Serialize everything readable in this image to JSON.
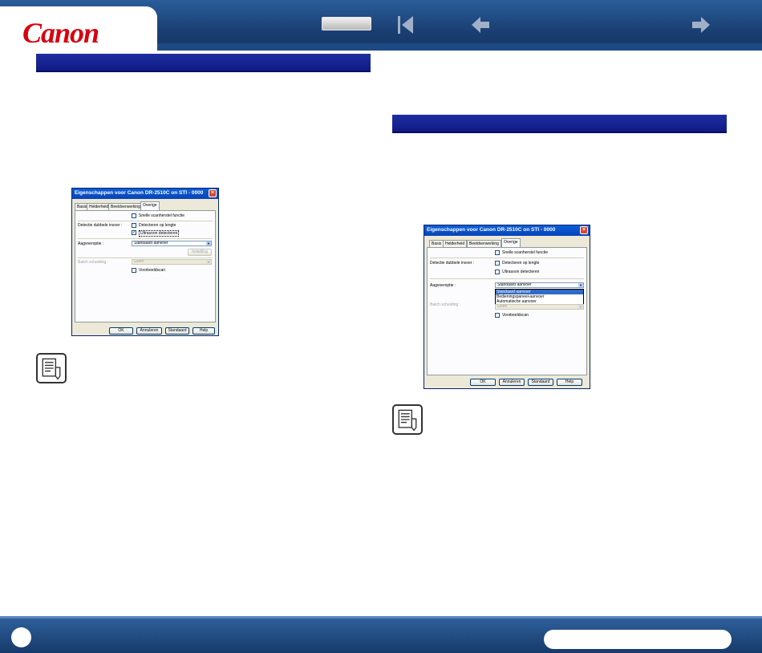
{
  "header": {
    "logo_text": "Canon",
    "nav_icons": [
      "first-page-icon",
      "back-arrow-icon",
      "forward-arrow-icon"
    ]
  },
  "dialog1": {
    "title": "Eigenschappen voor Canon DR-2510C on STI - 0000",
    "tabs": [
      "Basis",
      "Helderheid",
      "Beeldverwerking",
      "Overige"
    ],
    "active_tab": "Overige",
    "snelle_label": "Snelle scanherstel functie",
    "dubbele_label": "Detectie dubbele invoer :",
    "detecteren_lengte": "Detecteren op lengte",
    "ultrasoon": "Ultrasoon detecteren",
    "aanvoer_label": "Aagvoeroptie :",
    "aanvoer_value": "Standaard aanvoer",
    "instelling_btn": "Instelling",
    "batch_label": "Batch scheiding :",
    "batch_value": "Geen",
    "voorbeeld": "Voorbeeldscan",
    "buttons": [
      "OK",
      "Annuleren",
      "Standaard",
      "Help"
    ]
  },
  "dialog2": {
    "title": "Eigenschappen voor Canon DR-2510C on STI - 0000",
    "tabs": [
      "Basis",
      "Helderheid",
      "Beeldverwerking",
      "Overige"
    ],
    "active_tab": "Overige",
    "snelle_label": "Snelle scanherstel functie",
    "dubbele_label": "Detectie dubbele invoer :",
    "detecteren_lengte": "Detecteren op lengte",
    "ultrasoon": "Ultrasoon detecteren",
    "aanvoer_label": "Aagvoeroptie :",
    "aanvoer_value": "Standaard aanvoer",
    "dropdown_options": [
      "Standaard aanvoer",
      "Bedieningspaneel-aanvoer",
      "Automatische aanvoer"
    ],
    "batch_label": "Batch scheiding :",
    "batch_value": "Geen",
    "voorbeeld": "Voorbeeldscan",
    "buttons": [
      "OK",
      "Annuleren",
      "Standaard",
      "Help"
    ]
  },
  "colors": {
    "header_blue": "#1a3f73",
    "section_bar_blue": "#1e2fa0",
    "canon_red": "#d7000f"
  }
}
